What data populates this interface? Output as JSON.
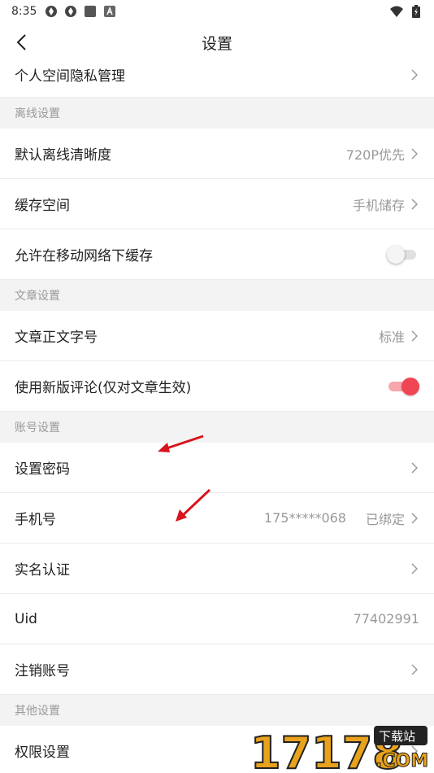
{
  "status_bar": {
    "time": "8:35"
  },
  "nav": {
    "title": "设置"
  },
  "rows": {
    "privacy": {
      "label": "个人空间隐私管理"
    },
    "offline_quality": {
      "label": "默认离线清晰度",
      "value": "720P优先"
    },
    "cache_space": {
      "label": "缓存空间",
      "value": "手机储存"
    },
    "mobile_cache": {
      "label": "允许在移动网络下缓存",
      "enabled": false
    },
    "font_size": {
      "label": "文章正文字号",
      "value": "标准"
    },
    "new_comment": {
      "label": "使用新版评论(仅对文章生效)",
      "enabled": true
    },
    "set_password": {
      "label": "设置密码"
    },
    "phone": {
      "label": "手机号",
      "number": "175*****068",
      "status": "已绑定"
    },
    "realname": {
      "label": "实名认证"
    },
    "uid": {
      "label": "Uid",
      "value": "77402991"
    },
    "cancel_account": {
      "label": "注销账号"
    },
    "permissions": {
      "label": "权限设置"
    }
  },
  "sections": {
    "offline": "离线设置",
    "article": "文章设置",
    "account": "账号设置",
    "other": "其他设置"
  },
  "watermark": {
    "text_main": "17178",
    "text_badge": "下载站",
    "text_suffix": ".COM"
  },
  "colors": {
    "accent": "#f04653",
    "annotation_arrow": "#d8141c"
  }
}
